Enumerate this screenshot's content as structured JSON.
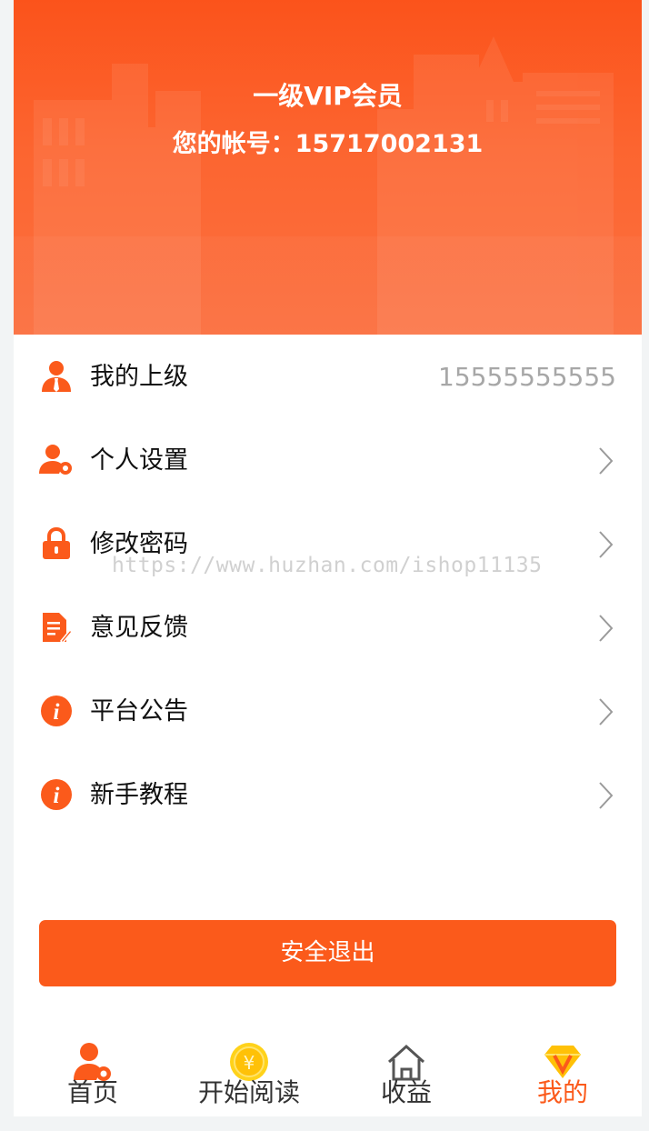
{
  "header": {
    "vip_title": "一级VIP会员",
    "account_label": "您的帐号：",
    "account_number": "15717002131"
  },
  "menu": {
    "items": [
      {
        "label": "我的上级",
        "value": "15555555555",
        "icon": "user-tie-icon"
      },
      {
        "label": "个人设置",
        "icon": "user-gear-icon"
      },
      {
        "label": "修改密码",
        "icon": "lock-icon"
      },
      {
        "label": "意见反馈",
        "icon": "document-edit-icon"
      },
      {
        "label": "平台公告",
        "icon": "info-icon"
      },
      {
        "label": "新手教程",
        "icon": "info-icon"
      }
    ]
  },
  "watermark": "https://www.huzhan.com/ishop11135",
  "logout_label": "安全退出",
  "tabbar": {
    "tabs": [
      {
        "label": "首页",
        "icon": "user-gear-icon"
      },
      {
        "label": "开始阅读",
        "icon": "coin-icon"
      },
      {
        "label": "收益",
        "icon": "home-icon"
      },
      {
        "label": "我的",
        "icon": "diamond-v-icon",
        "active": true
      }
    ]
  },
  "colors": {
    "accent": "#fb5a1b",
    "header_top": "#fb531b",
    "header_bottom": "#fb7040",
    "muted_value": "#a7a7a7"
  }
}
